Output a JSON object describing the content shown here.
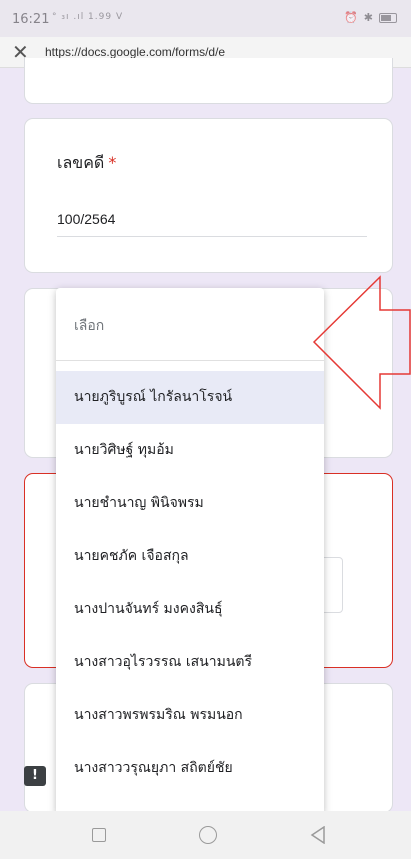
{
  "status_bar": {
    "time": "16:21",
    "network": "° ₃ı .ıl 1.99 Ⅴ",
    "icons": [
      "alarm-icon",
      "bluetooth-icon",
      "battery-icon"
    ]
  },
  "browser": {
    "close_icon": "close-icon",
    "url": "https://docs.google.com/forms/d/e"
  },
  "form": {
    "case_number_question": {
      "label": "เลขคดี",
      "required_mark": "*",
      "value": "100/2564"
    }
  },
  "dropdown": {
    "placeholder": "เลือก",
    "options": [
      "นายภูริบูรณ์ ไกรัลนาโรจน์",
      "นายวิศิษฐ์ ทุมอ้ม",
      "นายชำนาญ พินิจพรม",
      "นายคชภัค เจือสกุล",
      "นางปานจันทร์ มงคงสินธุ์",
      "นางสาวอุไรวรรณ เสนามนตรี",
      "นางสาวพรพรมริณ พรมนอก",
      "นางสาววรุณยุภา สถิตย์ชัย"
    ],
    "selected_index": 0
  },
  "feedback": {
    "label": "!"
  },
  "annotation": {
    "arrow_color": "#e53935"
  },
  "colors": {
    "background": "#ede7f6",
    "required": "#d93025",
    "error_border": "#d93025",
    "selected": "#e8eaf6"
  }
}
